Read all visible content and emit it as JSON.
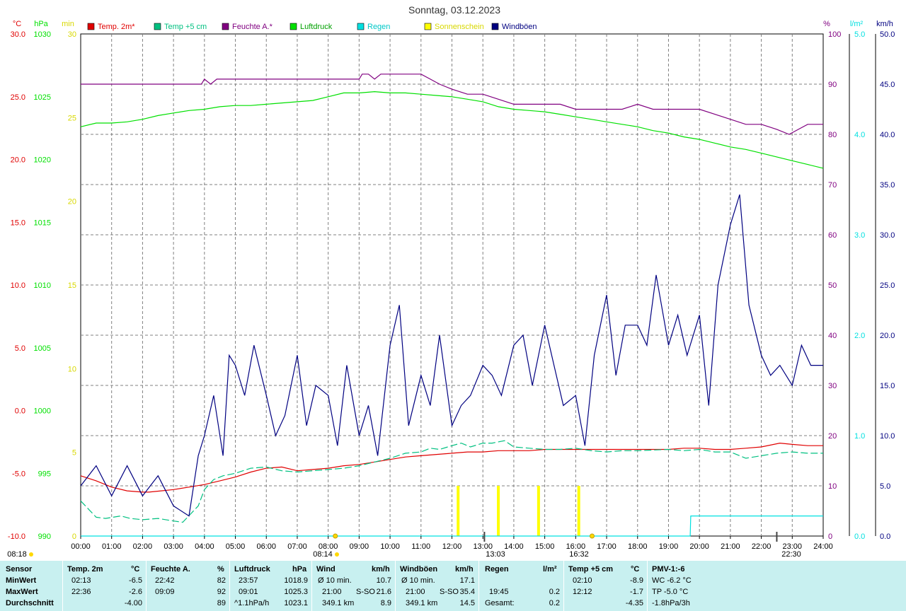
{
  "title": "Sonntag, 03.12.2023",
  "colors": {
    "temp2m": "#e00000",
    "temp5cm": "#00c080",
    "feuchte": "#800080",
    "luftdruck": "#00e000",
    "regen": "#00e0e0",
    "sonne": "#ffff00",
    "windboeen": "#000080",
    "grid": "#808080",
    "panel": "#c8f0f0"
  },
  "chart_data": {
    "type": "line",
    "title": "Sonntag, 03.12.2023",
    "x_unit": "hour of day",
    "x_ticks": [
      "00:00",
      "01:00",
      "02:00",
      "03:00",
      "04:00",
      "05:00",
      "06:00",
      "07:00",
      "08:00",
      "09:00",
      "10:00",
      "11:00",
      "12:00",
      "13:00",
      "14:00",
      "15:00",
      "16:00",
      "17:00",
      "18:00",
      "19:00",
      "20:00",
      "21:00",
      "22:00",
      "23:00",
      "24:00"
    ],
    "axes": {
      "temp": {
        "unit": "°C",
        "range": [
          -10,
          30
        ],
        "ticks": [
          "-10.0",
          "-5.0",
          "0.0",
          "5.0",
          "10.0",
          "15.0",
          "20.0",
          "25.0",
          "30.0"
        ]
      },
      "pressure": {
        "unit": "hPa",
        "range": [
          990,
          1030
        ],
        "ticks": [
          "990",
          "995",
          "1000",
          "1005",
          "1010",
          "1015",
          "1020",
          "1025",
          "1030"
        ]
      },
      "minutes": {
        "unit": "min",
        "range": [
          0,
          30
        ],
        "ticks": [
          "0",
          "5",
          "10",
          "15",
          "20",
          "25",
          "30"
        ]
      },
      "humidity": {
        "unit": "%",
        "range": [
          0,
          100
        ],
        "ticks": [
          "0",
          "10",
          "20",
          "30",
          "40",
          "50",
          "60",
          "70",
          "80",
          "90",
          "100"
        ]
      },
      "rain": {
        "unit": "l/m²",
        "range": [
          0,
          5
        ],
        "ticks": [
          "0.0",
          "1.0",
          "2.0",
          "3.0",
          "4.0",
          "5.0"
        ]
      },
      "wind": {
        "unit": "km/h",
        "range": [
          0,
          50
        ],
        "ticks": [
          "0.0",
          "5.0",
          "10.0",
          "15.0",
          "20.0",
          "25.0",
          "30.0",
          "35.0",
          "40.0",
          "45.0",
          "50.0"
        ]
      }
    },
    "legend": [
      "Temp. 2m*",
      "Temp +5 cm",
      "Feuchte A.*",
      "Luftdruck",
      "Regen",
      "Sonnenschein",
      "Windböen"
    ],
    "series": [
      {
        "name": "Temp. 2m*",
        "axis": "temp",
        "x": [
          0,
          0.5,
          1,
          1.5,
          2,
          2.2,
          2.6,
          3,
          3.5,
          4,
          4.5,
          5,
          5.5,
          6,
          6.5,
          7,
          7.5,
          8,
          8.5,
          9,
          9.5,
          10,
          10.5,
          11,
          11.5,
          12,
          12.5,
          13,
          13.5,
          14,
          14.5,
          15,
          15.5,
          16,
          16.5,
          17,
          17.5,
          18,
          18.5,
          19,
          19.5,
          20,
          20.5,
          21,
          21.5,
          22,
          22.6,
          23,
          23.5,
          24
        ],
        "y": [
          -5.2,
          -5.6,
          -6.1,
          -6.4,
          -6.5,
          -6.5,
          -6.4,
          -6.3,
          -6.1,
          -5.9,
          -5.6,
          -5.3,
          -4.9,
          -4.6,
          -4.5,
          -4.8,
          -4.7,
          -4.6,
          -4.4,
          -4.3,
          -4.1,
          -3.9,
          -3.7,
          -3.6,
          -3.5,
          -3.4,
          -3.3,
          -3.3,
          -3.2,
          -3.2,
          -3.2,
          -3.1,
          -3.1,
          -3.1,
          -3.1,
          -3.1,
          -3.1,
          -3.1,
          -3.1,
          -3.1,
          -3.0,
          -3.0,
          -3.1,
          -3.1,
          -3.0,
          -2.9,
          -2.6,
          -2.7,
          -2.8,
          -2.8
        ]
      },
      {
        "name": "Temp +5 cm",
        "axis": "temp",
        "x": [
          0,
          0.5,
          0.8,
          1.3,
          1.6,
          2,
          2.5,
          3,
          3.3,
          3.8,
          4,
          4.3,
          4.6,
          5,
          5.5,
          6,
          6.5,
          7,
          7.5,
          8,
          8.5,
          9,
          9.5,
          10,
          10.5,
          11,
          11.3,
          11.6,
          12,
          12.3,
          12.6,
          13,
          13.3,
          13.7,
          14,
          14.5,
          15,
          15.5,
          16,
          16.5,
          17,
          17.5,
          18,
          19,
          19.5,
          20,
          20.5,
          21,
          21.5,
          22,
          22.5,
          23,
          23.5,
          24
        ],
        "y": [
          -7.2,
          -8.5,
          -8.6,
          -8.4,
          -8.6,
          -8.7,
          -8.6,
          -8.8,
          -8.9,
          -7.6,
          -6.3,
          -5.5,
          -5.2,
          -5.0,
          -4.6,
          -4.5,
          -4.8,
          -4.9,
          -4.8,
          -4.7,
          -4.6,
          -4.4,
          -4.1,
          -3.8,
          -3.4,
          -3.3,
          -3.0,
          -3.1,
          -2.8,
          -2.6,
          -2.9,
          -2.6,
          -2.6,
          -2.4,
          -2.9,
          -3.0,
          -3.1,
          -3.1,
          -3.0,
          -3.2,
          -3.3,
          -3.2,
          -3.2,
          -3.1,
          -3.2,
          -3.1,
          -3.3,
          -3.3,
          -3.8,
          -3.6,
          -3.4,
          -3.3,
          -3.4,
          -3.4
        ]
      },
      {
        "name": "Feuchte A.*",
        "axis": "humidity",
        "x": [
          0,
          1,
          2,
          3,
          3.9,
          4,
          4.2,
          4.4,
          5,
          6,
          7,
          7.5,
          8,
          9,
          9.1,
          9.3,
          9.5,
          9.7,
          10,
          11,
          11.3,
          11.6,
          12,
          12.5,
          13,
          13.5,
          14,
          14.5,
          15,
          15.5,
          16,
          16.5,
          17,
          17.5,
          18,
          18.5,
          19,
          19.5,
          20,
          20.5,
          21,
          21.5,
          22,
          22.5,
          22.9,
          23.2,
          23.5,
          24
        ],
        "y": [
          90,
          90,
          90,
          90,
          90,
          91,
          90,
          91,
          91,
          91,
          91,
          91,
          91,
          91,
          92,
          92,
          91,
          92,
          92,
          92,
          91,
          90,
          89,
          88,
          88,
          87,
          86,
          86,
          86,
          86,
          85,
          85,
          85,
          85,
          86,
          85,
          85,
          85,
          85,
          84,
          83,
          82,
          82,
          81,
          80,
          81,
          82,
          82
        ]
      },
      {
        "name": "Luftdruck",
        "axis": "pressure",
        "x": [
          0,
          0.5,
          1,
          1.5,
          2,
          2.5,
          3,
          3.5,
          4,
          4.5,
          5,
          5.5,
          6,
          6.5,
          7,
          7.5,
          8,
          8.5,
          9,
          9.5,
          10,
          10.5,
          11,
          11.5,
          12,
          12.5,
          13,
          13.5,
          14,
          14.5,
          15,
          15.5,
          16,
          16.5,
          17,
          17.5,
          18,
          18.5,
          19,
          19.5,
          20,
          20.5,
          21,
          21.5,
          22,
          22.5,
          23,
          23.5,
          24
        ],
        "y": [
          1022.6,
          1022.9,
          1022.9,
          1023.0,
          1023.2,
          1023.5,
          1023.7,
          1023.9,
          1024.0,
          1024.2,
          1024.3,
          1024.3,
          1024.4,
          1024.5,
          1024.6,
          1024.7,
          1025.0,
          1025.3,
          1025.3,
          1025.4,
          1025.3,
          1025.3,
          1025.2,
          1025.1,
          1025.0,
          1024.8,
          1024.6,
          1024.2,
          1024.0,
          1023.9,
          1023.8,
          1023.6,
          1023.4,
          1023.2,
          1023.0,
          1022.8,
          1022.6,
          1022.3,
          1022.1,
          1021.8,
          1021.6,
          1021.3,
          1021.0,
          1020.8,
          1020.5,
          1020.2,
          1019.9,
          1019.6,
          1019.3
        ]
      },
      {
        "name": "Regen",
        "axis": "rain",
        "x": [
          0,
          19.7,
          19.72,
          24
        ],
        "y": [
          0,
          0,
          0.2,
          0.2
        ]
      },
      {
        "name": "Windböen",
        "axis": "wind",
        "x": [
          0,
          0.5,
          1,
          1.5,
          2,
          2.5,
          3,
          3.5,
          3.8,
          4,
          4.3,
          4.6,
          4.8,
          5,
          5.3,
          5.6,
          6,
          6.3,
          6.6,
          7,
          7.3,
          7.6,
          8,
          8.3,
          8.6,
          9,
          9.3,
          9.6,
          10,
          10.3,
          10.6,
          11,
          11.3,
          11.6,
          12,
          12.3,
          12.6,
          13,
          13.3,
          13.6,
          14,
          14.3,
          14.6,
          15,
          15.3,
          15.6,
          16,
          16.3,
          16.6,
          17,
          17.3,
          17.6,
          18,
          18.3,
          18.6,
          19,
          19.3,
          19.6,
          20,
          20.3,
          20.6,
          21,
          21.3,
          21.6,
          22,
          22.3,
          22.6,
          23,
          23.3,
          23.6,
          24
        ],
        "y": [
          5,
          7,
          4,
          7,
          4,
          6,
          3,
          2,
          8,
          10,
          14,
          8,
          18,
          17,
          14,
          19,
          14,
          10,
          12,
          18,
          11,
          15,
          14,
          9,
          17,
          10,
          13,
          8,
          19,
          23,
          11,
          16,
          13,
          20,
          11,
          13,
          14,
          17,
          16,
          14,
          19,
          20,
          15,
          21,
          17,
          13,
          14,
          9,
          18,
          24,
          16,
          21,
          21,
          19,
          26,
          19,
          22,
          18,
          22,
          13,
          25,
          31,
          34,
          23,
          18,
          16,
          17,
          15,
          19,
          17,
          17
        ]
      },
      {
        "name": "Sonnenschein",
        "axis": "minutes",
        "type": "bar",
        "x": [
          12.2,
          13.5,
          14.8,
          16.1
        ],
        "y": [
          3,
          3,
          3,
          3
        ]
      }
    ]
  },
  "time_labels": {
    "sunrise": "08:14",
    "noon": "13:03",
    "sunset": "16:32",
    "moon_left": "08:18",
    "moon_right": "22:30"
  },
  "stats": {
    "sensor": {
      "header": "Sensor",
      "rows": [
        "MinWert",
        "MaxWert",
        "Durchschnitt"
      ]
    },
    "temp2m": {
      "header": "Temp. 2m",
      "unit": "°C",
      "rows": [
        [
          "02:13",
          "-6.5"
        ],
        [
          "22:36",
          "-2.6"
        ],
        [
          "",
          "-4.00"
        ]
      ]
    },
    "feuchte": {
      "header": "Feuchte A.",
      "unit": "%",
      "rows": [
        [
          "22:42",
          "82"
        ],
        [
          "09:09",
          "92"
        ],
        [
          "",
          "89"
        ]
      ]
    },
    "luftdruck": {
      "header": "Luftdruck",
      "unit": "hPa",
      "rows": [
        [
          "23:57",
          "1018.9"
        ],
        [
          "09:01",
          "1025.3"
        ],
        [
          "^1.1hPa/h",
          "1023.1"
        ]
      ]
    },
    "wind": {
      "header": "Wind",
      "unit": "km/h",
      "rows": [
        [
          "Ø 10 min.",
          "",
          "10.7"
        ],
        [
          "21:00",
          "S-SO",
          "21.6"
        ],
        [
          "349.1 km",
          "",
          "8.9"
        ]
      ]
    },
    "windboeen": {
      "header": "Windböen",
      "unit": "km/h",
      "rows": [
        [
          "Ø 10 min.",
          "",
          "17.1"
        ],
        [
          "21:00",
          "S-SO",
          "35.4"
        ],
        [
          "349.1 km",
          "",
          "14.5"
        ]
      ]
    },
    "regen": {
      "header": "Regen",
      "unit": "l/m²",
      "rows": [
        [
          "",
          ""
        ],
        [
          "19:45",
          "0.2"
        ],
        [
          "Gesamt:",
          "0.2"
        ]
      ]
    },
    "temp5cm": {
      "header": "Temp +5 cm",
      "unit": "°C",
      "rows": [
        [
          "02:10",
          "-8.9"
        ],
        [
          "12:12",
          "-1.7"
        ],
        [
          "",
          "-4.35"
        ]
      ]
    },
    "pmv": {
      "header": "PMV-1:-6",
      "rows": [
        "WC -6.2 °C",
        "TP -5.0 °C",
        "-1.8hPa/3h"
      ]
    }
  }
}
